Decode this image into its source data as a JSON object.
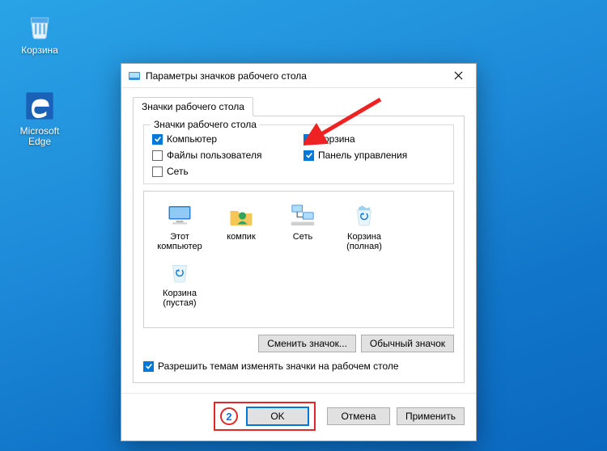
{
  "desktop": {
    "icons": [
      {
        "id": "recycle-bin",
        "label": "Корзина"
      },
      {
        "id": "edge",
        "label": "Microsoft Edge"
      }
    ]
  },
  "window": {
    "title": "Параметры значков рабочего стола"
  },
  "tab": {
    "label": "Значки рабочего стола"
  },
  "group": {
    "legend": "Значки рабочего стола",
    "checks": {
      "computer": {
        "label": "Компьютер",
        "checked": true
      },
      "user_files": {
        "label": "Файлы пользователя",
        "checked": false
      },
      "network": {
        "label": "Сеть",
        "checked": false
      },
      "recycle": {
        "label": "Корзина",
        "checked": true
      },
      "control_panel": {
        "label": "Панель управления",
        "checked": true
      }
    }
  },
  "iconViews": [
    {
      "id": "this-pc",
      "label": "Этот компьютер"
    },
    {
      "id": "user-folder",
      "label": "компик"
    },
    {
      "id": "network",
      "label": "Сеть"
    },
    {
      "id": "recycle-full",
      "label": "Корзина (полная)"
    },
    {
      "id": "recycle-empty",
      "label": "Корзина (пустая)"
    }
  ],
  "buttons": {
    "change_icon": "Сменить значок...",
    "default_icon": "Обычный значок",
    "ok": "OK",
    "cancel": "Отмена",
    "apply": "Применить"
  },
  "allowThemes": {
    "label": "Разрешить темам изменять значки на рабочем столе",
    "checked": true
  },
  "annotation": {
    "step": "2"
  }
}
